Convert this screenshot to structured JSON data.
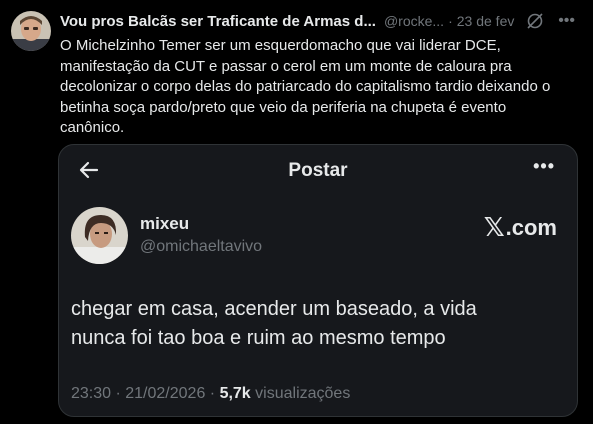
{
  "tweet": {
    "author_name": "Vou pros Balcãs ser Traficante de Armas d...",
    "author_handle": "@rocke...",
    "separator": "·",
    "time": "23 de fev",
    "text": "O Michelzinho Temer ser um esquerdomacho que vai liderar DCE,\nmanifestação da CUT e passar o cerol em um monte de caloura pra\ndecolonizar o corpo delas do patriarcado do capitalismo tardio deixando o\nbetinha soça pardo/preto que veio da periferia na chupeta é evento\ncanônico.",
    "icons": {
      "avatar": "avatar-photo",
      "grok": "grok-icon",
      "more": "more-icon"
    }
  },
  "embedded_post": {
    "header_title": "Postar",
    "more_label": "•••",
    "author_name": "mixeu",
    "author_handle": "@omichaeltavivo",
    "brand_mark": "𝕏",
    "brand_text": ".com",
    "text": "chegar em casa, acender um baseado, a vida\nnunca foi tao boa e ruim ao mesmo tempo",
    "timestamp": "23:30 · 21/02/2026 ·",
    "views_count": "5,7k",
    "views_label": "visualizações",
    "icons": {
      "back": "back-arrow-icon",
      "avatar": "avatar-photo"
    }
  },
  "colors": {
    "background": "#000000",
    "card": "#16181c",
    "text": "#e7e9ea",
    "muted": "#71767b",
    "border": "#2f3336"
  }
}
